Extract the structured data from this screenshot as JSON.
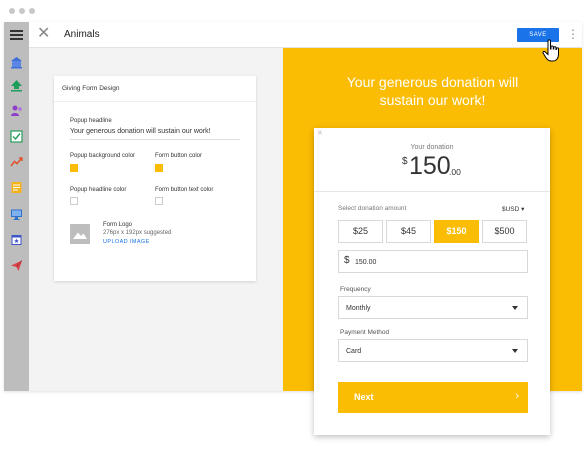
{
  "app": {
    "title": "Animals",
    "save_label": "SAVE",
    "close_glyph": "✕",
    "more_glyph": "⋮",
    "rail_icons": [
      "bank-icon",
      "upload-icon",
      "people-icon",
      "checklist-icon",
      "trend-chart-icon",
      "notes-icon",
      "monitor-icon",
      "calendar-star-icon",
      "paper-plane-icon"
    ]
  },
  "design_card": {
    "heading": "Giving Form Design",
    "popup_headline_label": "Popup headline",
    "popup_headline_value": "Your generous donation will sustain our work!",
    "popup_bg_color_label": "Popup background color",
    "form_button_color_label": "Form button color",
    "popup_headline_color_label": "Popup headline color",
    "form_button_text_color_label": "Form button text color",
    "form_logo_label": "Form Logo",
    "form_logo_hint": "276px x 192px suggested",
    "upload_label": "UPLOAD IMAGE"
  },
  "preview": {
    "headline_line1": "Your generous donation will",
    "headline_line2": "sustain our work!",
    "close_glyph": "✕",
    "your_donation_label": "Your donation",
    "amount_currency": "$",
    "amount_main": "150",
    "amount_cents": ".00",
    "select_amount_label": "Select donation amount",
    "currency_selector": "$USD ▾",
    "amount_options": [
      "$25",
      "$45",
      "$150",
      "$500"
    ],
    "selected_option": "$150",
    "amount_input_currency": "$",
    "amount_input_value": "150.00",
    "frequency_label": "Frequency",
    "frequency_value": "Monthly",
    "payment_method_label": "Payment Method",
    "payment_method_value": "Card",
    "next_label": "Next",
    "next_arrow": "›"
  },
  "colors": {
    "accent_yellow": "#fbbc04",
    "save_blue": "#1a73e8"
  }
}
